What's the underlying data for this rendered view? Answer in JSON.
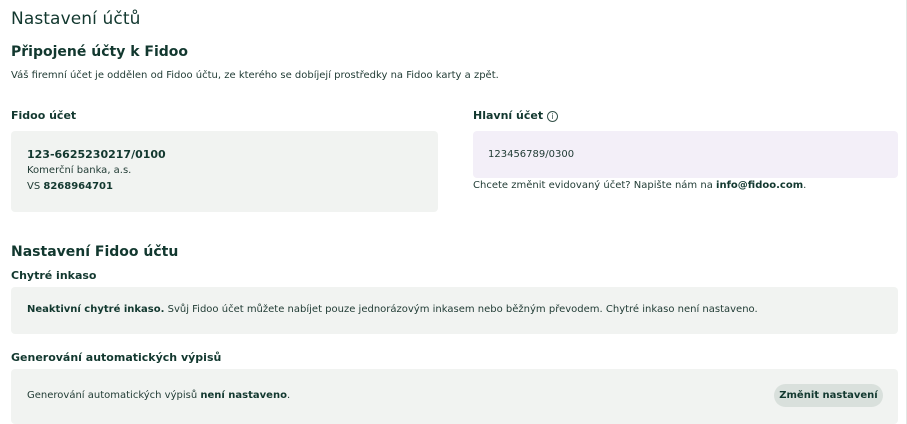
{
  "page": {
    "title": "Nastavení účtů"
  },
  "connected": {
    "heading": "Připojené účty k Fidoo",
    "description": "Váš firemní účet je oddělen od Fidoo účtu, ze kterého se dobíjejí prostředky na Fidoo karty a zpět.",
    "fidoo_account": {
      "label": "Fidoo účet",
      "number": "123-6625230217/0100",
      "bank": "Komerční banka, a.s.",
      "vs_prefix": "VS",
      "vs_value": "8268964701"
    },
    "main_account": {
      "label": "Hlavní účet",
      "info_glyph": "i",
      "number": "123456789/0300",
      "change_text": "Chcete změnit evidovaný účet? Napište nám na",
      "email": "info@fidoo.com",
      "change_suffix": "."
    }
  },
  "settings": {
    "heading": "Nastavení Fidoo účtu",
    "smart_collection": {
      "label": "Chytré inkaso",
      "status_bold": "Neaktivní chytré inkaso.",
      "status_text": " Svůj Fidoo účet můžete nabíjet pouze jednorázovým inkasem nebo běžným převodem. Chytré inkaso není nastaveno."
    },
    "auto_statements": {
      "label": "Generování automatických výpisů",
      "text": "Generování automatických výpisů ",
      "text_bold": "není nastaveno",
      "text_suffix": ".",
      "button_label": "Změnit nastavení"
    }
  }
}
